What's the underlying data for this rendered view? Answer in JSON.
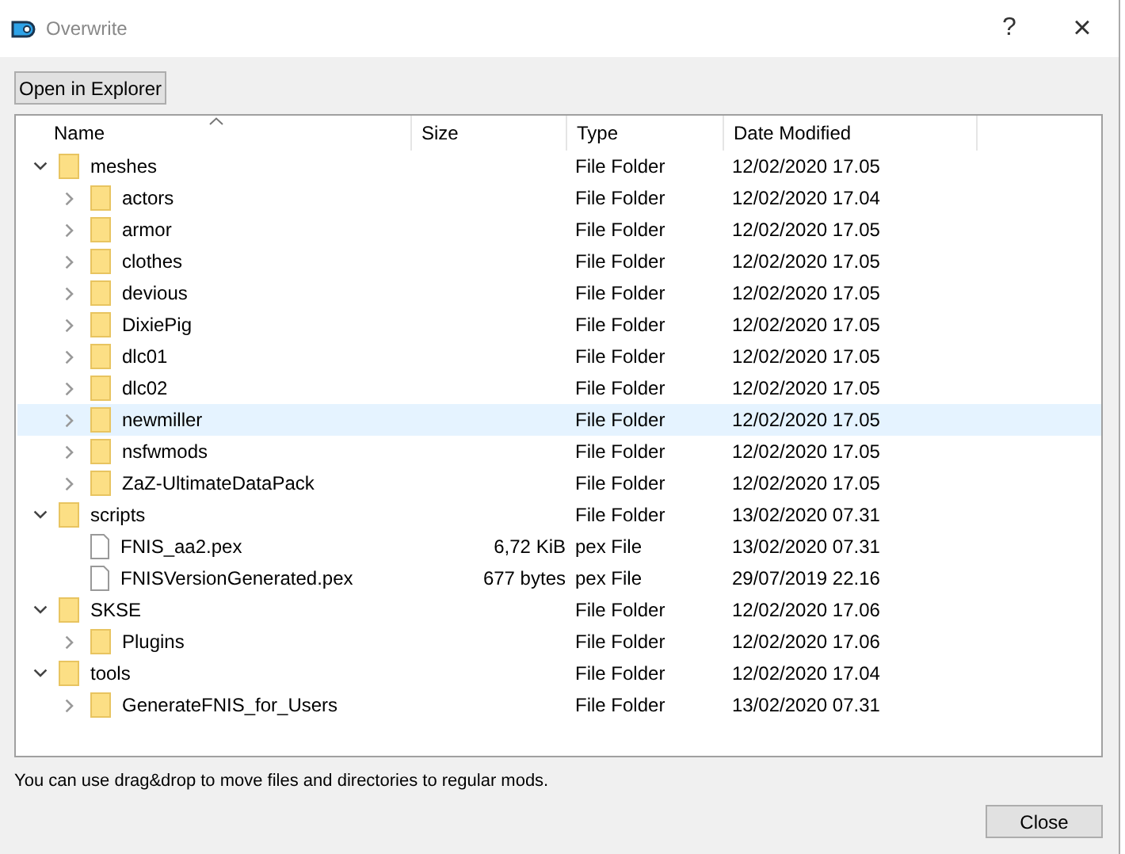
{
  "window": {
    "title": "Overwrite",
    "help": "?",
    "close": "×"
  },
  "toolbar": {
    "open_button": "Open in Explorer"
  },
  "table": {
    "columns": [
      "Name",
      "Size",
      "Type",
      "Date Modified"
    ],
    "rows": [
      {
        "kind": "folder",
        "name": "meshes",
        "type": "File Folder",
        "date": "12/02/2020 17.05",
        "expanded": true,
        "selected": false,
        "children": [
          {
            "kind": "folder",
            "name": "actors",
            "type": "File Folder",
            "date": "12/02/2020 17.04",
            "expanded": false,
            "selected": false
          },
          {
            "kind": "folder",
            "name": "armor",
            "type": "File Folder",
            "date": "12/02/2020 17.05",
            "expanded": false,
            "selected": false
          },
          {
            "kind": "folder",
            "name": "clothes",
            "type": "File Folder",
            "date": "12/02/2020 17.05",
            "expanded": false,
            "selected": false
          },
          {
            "kind": "folder",
            "name": "devious",
            "type": "File Folder",
            "date": "12/02/2020 17.05",
            "expanded": false,
            "selected": false
          },
          {
            "kind": "folder",
            "name": "DixiePig",
            "type": "File Folder",
            "date": "12/02/2020 17.05",
            "expanded": false,
            "selected": false
          },
          {
            "kind": "folder",
            "name": "dlc01",
            "type": "File Folder",
            "date": "12/02/2020 17.05",
            "expanded": false,
            "selected": false
          },
          {
            "kind": "folder",
            "name": "dlc02",
            "type": "File Folder",
            "date": "12/02/2020 17.05",
            "expanded": false,
            "selected": false
          },
          {
            "kind": "folder",
            "name": "newmiller",
            "type": "File Folder",
            "date": "12/02/2020 17.05",
            "expanded": false,
            "selected": true
          },
          {
            "kind": "folder",
            "name": "nsfwmods",
            "type": "File Folder",
            "date": "12/02/2020 17.05",
            "expanded": false,
            "selected": false
          },
          {
            "kind": "folder",
            "name": "ZaZ-UltimateDataPack",
            "type": "File Folder",
            "date": "12/02/2020 17.05",
            "expanded": false,
            "selected": false
          }
        ]
      },
      {
        "kind": "folder",
        "name": "scripts",
        "type": "File Folder",
        "date": "13/02/2020 07.31",
        "expanded": true,
        "selected": false,
        "children": [
          {
            "kind": "file",
            "name": "FNIS_aa2.pex",
            "size": "6,72 KiB",
            "type": "pex File",
            "date": "13/02/2020 07.31",
            "selected": false
          },
          {
            "kind": "file",
            "name": "FNISVersionGenerated.pex",
            "size": "677 bytes",
            "type": "pex File",
            "date": "29/07/2019 22.16",
            "selected": false
          }
        ]
      },
      {
        "kind": "folder",
        "name": "SKSE",
        "type": "File Folder",
        "date": "12/02/2020 17.06",
        "expanded": true,
        "selected": false,
        "children": [
          {
            "kind": "folder",
            "name": "Plugins",
            "type": "File Folder",
            "date": "12/02/2020 17.06",
            "expanded": false,
            "selected": false
          }
        ]
      },
      {
        "kind": "folder",
        "name": "tools",
        "type": "File Folder",
        "date": "12/02/2020 17.04",
        "expanded": true,
        "selected": false,
        "children": [
          {
            "kind": "folder",
            "name": "GenerateFNIS_for_Users",
            "type": "File Folder",
            "date": "13/02/2020 07.31",
            "expanded": false,
            "selected": false
          }
        ]
      }
    ]
  },
  "hint": "You can use drag&drop to move files and directories to regular mods.",
  "close_button": "Close"
}
